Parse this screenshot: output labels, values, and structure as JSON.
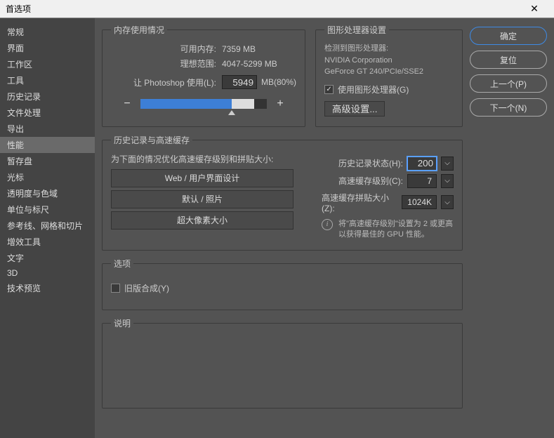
{
  "window": {
    "title": "首选项"
  },
  "sidebar": {
    "items": [
      {
        "label": "常规"
      },
      {
        "label": "界面"
      },
      {
        "label": "工作区"
      },
      {
        "label": "工具"
      },
      {
        "label": "历史记录"
      },
      {
        "label": "文件处理"
      },
      {
        "label": "导出"
      },
      {
        "label": "性能"
      },
      {
        "label": "暂存盘"
      },
      {
        "label": "光标"
      },
      {
        "label": "透明度与色域"
      },
      {
        "label": "单位与标尺"
      },
      {
        "label": "参考线、网格和切片"
      },
      {
        "label": "增效工具"
      },
      {
        "label": "文字"
      },
      {
        "label": "3D"
      },
      {
        "label": "技术预览"
      }
    ],
    "selectedIndex": 7
  },
  "buttons": {
    "ok": "确定",
    "reset": "复位",
    "prev": "上一个(P)",
    "next": "下一个(N)"
  },
  "memory": {
    "legend": "内存使用情况",
    "availLabel": "可用内存:",
    "availValue": "7359 MB",
    "idealLabel": "理想范围:",
    "idealValue": "4047-5299 MB",
    "useLabel": "让 Photoshop 使用(L):",
    "useValue": "5949",
    "useUnit": "MB(80%)",
    "minus": "−",
    "plus": "+"
  },
  "gpu": {
    "legend": "图形处理器设置",
    "detectedLabel": "检测到图形处理器:",
    "vendor": "NVIDIA Corporation",
    "model": "GeForce GT 240/PCIe/SSE2",
    "useGpu": "使用图形处理器(G)",
    "advanced": "高级设置..."
  },
  "history": {
    "legend": "历史记录与高速缓存",
    "optimize": "为下面的情况优化高速缓存级别和拼贴大小:",
    "presets": [
      "Web / 用户界面设计",
      "默认 / 照片",
      "超大像素大小"
    ],
    "statesLabel": "历史记录状态(H):",
    "statesValue": "200",
    "levelsLabel": "高速缓存级别(C):",
    "levelsValue": "7",
    "tileLabel": "高速缓存拼贴大小(Z):",
    "tileValue": "1024K",
    "tip": "将\"高速缓存级别\"设置为 2 或更高以获得最佳的 GPU 性能。"
  },
  "options": {
    "legend": "选项",
    "legacy": "旧版合成(Y)"
  },
  "desc": {
    "legend": "说明"
  }
}
